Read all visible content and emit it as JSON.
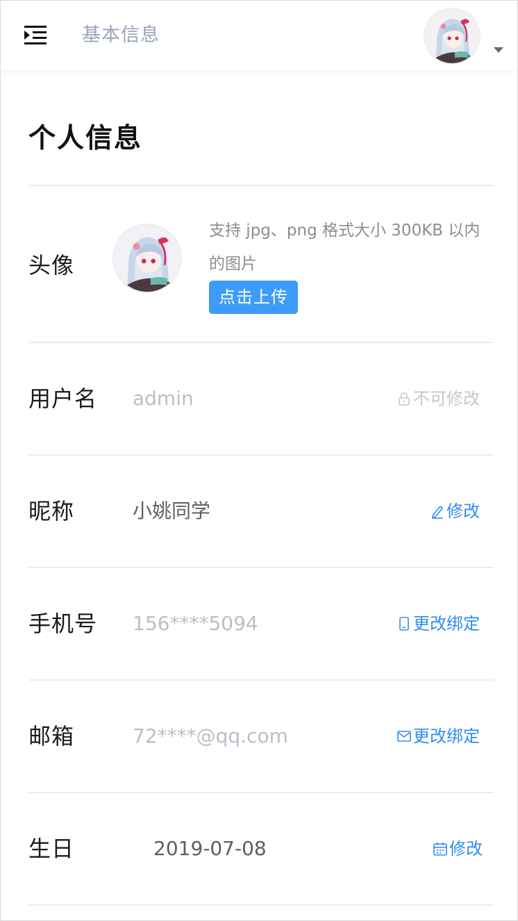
{
  "header": {
    "title": "基本信息",
    "menu_icon": "menu-indent-icon",
    "avatar_icon": "user-avatar",
    "dropdown_icon": "caret-down-icon"
  },
  "main": {
    "title": "个人信息",
    "avatar_row": {
      "label": "头像",
      "hint": "支持 jpg、png 格式大小 300KB 以内的图片",
      "upload_label": "点击上传"
    },
    "rows": [
      {
        "label": "用户名",
        "value": "admin",
        "action": "不可修改",
        "action_icon": "lock-icon",
        "value_color": "#b9bfc9",
        "action_color": "#c3c7ce"
      },
      {
        "label": "昵称",
        "value": "小姚同学",
        "action": "修改",
        "action_icon": "edit-icon",
        "value_color": "#5a5e66",
        "action_color": "#2f8df0"
      },
      {
        "label": "手机号",
        "value": "156****5094",
        "action": "更改绑定",
        "action_icon": "mobile-icon",
        "value_color": "#b9bfc9",
        "action_color": "#2f8df0"
      },
      {
        "label": "邮箱",
        "value": "72****@qq.com",
        "action": "更改绑定",
        "action_icon": "mail-icon",
        "value_color": "#b9bfc9",
        "action_color": "#2f8df0"
      },
      {
        "label": "生日",
        "value": "2019-07-08",
        "action": "修改",
        "action_icon": "calendar-icon",
        "value_color": "#5a5e66",
        "action_color": "#2f8df0"
      }
    ]
  },
  "colors": {
    "accent": "#3d9bfb",
    "link": "#2f8df0",
    "muted_text": "#b9bfc9",
    "header_title": "#98a4b8"
  }
}
